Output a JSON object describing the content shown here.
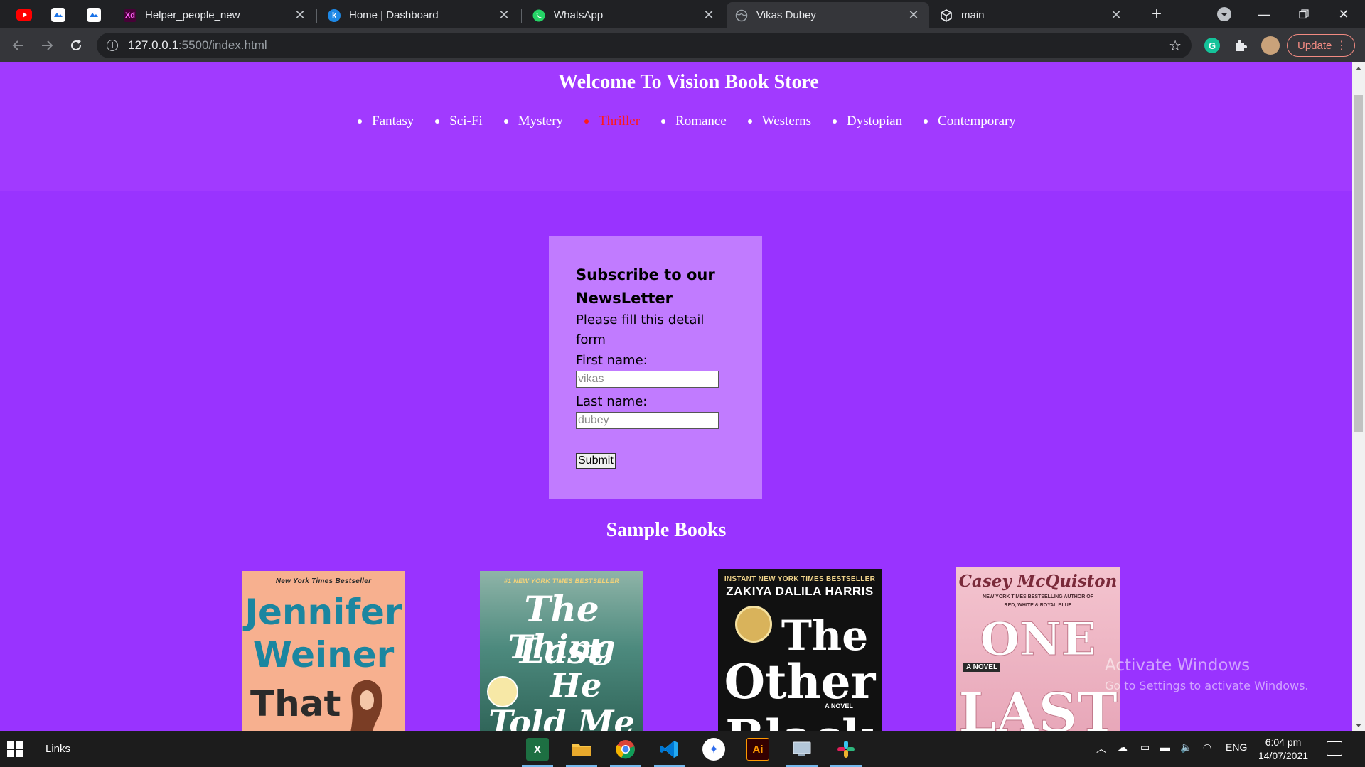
{
  "browser": {
    "tabs": [
      {
        "title": "Helper_people_new",
        "icon": "adobe-xd-icon",
        "active": false
      },
      {
        "title": "Home | Dashboard",
        "icon": "k-logo-icon",
        "active": false
      },
      {
        "title": "WhatsApp",
        "icon": "whatsapp-icon",
        "active": false
      },
      {
        "title": "Vikas Dubey",
        "icon": "globe-icon",
        "active": true
      },
      {
        "title": "main",
        "icon": "codesandbox-icon",
        "active": false
      }
    ],
    "pinned_icons": [
      "youtube-icon",
      "cloud-app-icon",
      "cloud-app-icon"
    ],
    "xd_fav_text": "Xd",
    "k_fav_text": "k",
    "url_host": "127.0.0.1",
    "url_rest": ":5500/index.html",
    "update_label": "Update"
  },
  "page": {
    "title": "Welcome To Vision Book Store",
    "nav": [
      "Fantasy",
      "Sci-Fi",
      "Mystery",
      "Thriller",
      "Romance",
      "Westerns",
      "Dystopian",
      "Contemporary"
    ],
    "nav_active": "Thriller",
    "form": {
      "heading": "Subscribe to our NewsLetter",
      "intro": "Please fill this detail form",
      "first_label": "First name:",
      "first_placeholder": "vikas",
      "last_label": "Last name:",
      "last_placeholder": "dubey",
      "submit_label": "Submit"
    },
    "sample_title": "Sample Books",
    "books": [
      {
        "top_line": "New York Times Bestseller",
        "author": "Jennifer",
        "line2": "Weiner",
        "line3": "That"
      },
      {
        "top_line": "#1 NEW YORK TIMES BESTSELLER",
        "line1": "The Last",
        "line2": "Thing",
        "line3": "He",
        "line4": "Told Me"
      },
      {
        "top_line": "INSTANT NEW YORK TIMES BESTSELLER",
        "author": "ZAKIYA DALILA HARRIS",
        "line1": "The",
        "line2": "Other",
        "line3": "Black",
        "small": "A NOVEL"
      },
      {
        "author": "Casey McQuiston",
        "top_line": "NEW YORK TIMES BESTSELLING AUTHOR OF",
        "sub_line": "RED, WHITE & ROYAL BLUE",
        "line1": "ONE",
        "line2": "LAST",
        "small": "A NOVEL"
      }
    ]
  },
  "watermark": {
    "line1": "Activate Windows",
    "line2": "Go to Settings to activate Windows."
  },
  "taskbar": {
    "links_label": "Links",
    "apps": [
      "excel-icon",
      "file-explorer-icon",
      "chrome-icon",
      "vscode-icon",
      "signal-icon",
      "illustrator-icon",
      "remote-desktop-icon",
      "slack-icon"
    ],
    "illustrator_text": "Ai",
    "language": "ENG",
    "time": "6:04 pm",
    "date": "14/07/2021"
  },
  "colors": {
    "page_bg": "#9933ff",
    "header_bg": "#a13aff",
    "form_bg": "#c17bff",
    "active_nav": "#ff1a1a"
  }
}
